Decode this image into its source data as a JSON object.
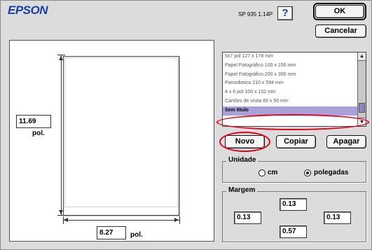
{
  "header": {
    "logo": "EPSON",
    "version": "SP 935 1.14P",
    "help_label": "?",
    "ok_label": "OK",
    "cancel_label": "Cancelar"
  },
  "preview": {
    "height_value": "11.69",
    "height_unit": "pol.",
    "width_value": "8.27",
    "width_unit": "pol."
  },
  "paper_list": {
    "items": [
      "5x7 pol 127 x 178 mm",
      "Papel Fotográfico 100 x 150 mm",
      "Papel Fotográfico 200 x 300 mm",
      "Panorâmico 210 x 594 mm",
      "4 x 6 pol 100 x 152 mm",
      "Cartões de visita 89 x 50 mm",
      "Sem título"
    ],
    "selected_index": 6
  },
  "actions": {
    "novo_label": "Novo",
    "copiar_label": "Copiar",
    "apagar_label": "Apagar"
  },
  "unidade": {
    "title": "Unidade",
    "options": [
      "cm",
      "polegadas"
    ],
    "selected": "polegadas"
  },
  "margem": {
    "title": "Margem",
    "top": "0.13",
    "left": "0.13",
    "right": "0.13",
    "bottom": "0.57"
  },
  "colors": {
    "logo": "#1a3f9e",
    "selection": "#a9a2da",
    "highlight": "#e0001b"
  }
}
